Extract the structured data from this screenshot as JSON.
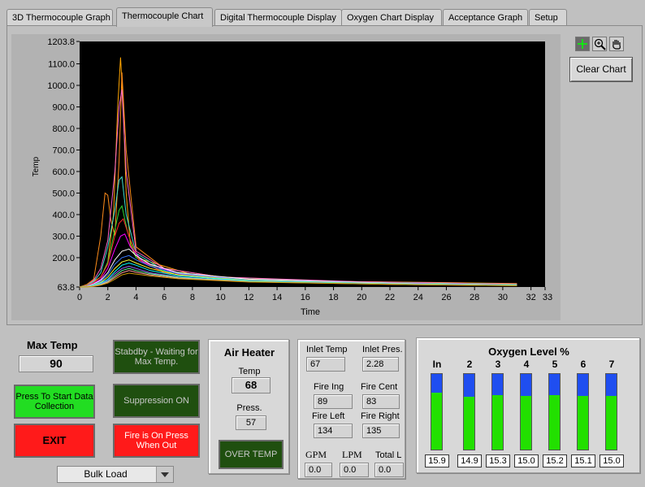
{
  "tabs": [
    {
      "label": "3D Thermocouple Graph"
    },
    {
      "label": "Thermocouple Chart"
    },
    {
      "label": "Digital Thermocouple Display"
    },
    {
      "label": "Oxygen Chart Display"
    },
    {
      "label": "Acceptance Graph"
    },
    {
      "label": "Setup"
    }
  ],
  "active_tab": "Thermocouple Chart",
  "chart_data": {
    "type": "line",
    "ylabel": "Temp",
    "xlabel": "Time",
    "ylim": [
      63.8,
      1203.8
    ],
    "xlim": [
      0,
      33
    ],
    "y_ticks": [
      "63.8",
      "200.0",
      "300.0",
      "400.0",
      "500.0",
      "600.0",
      "700.0",
      "800.0",
      "900.0",
      "1000.0",
      "1100.0",
      "1203.8"
    ],
    "x_ticks": [
      "0",
      "2",
      "4",
      "6",
      "8",
      "10",
      "12",
      "14",
      "16",
      "18",
      "20",
      "22",
      "24",
      "26",
      "28",
      "30",
      "32",
      "33"
    ],
    "grid": false,
    "background": "#000000",
    "series": [
      {
        "color": "#ffa500",
        "x": [
          0,
          0.5,
          1,
          1.5,
          2,
          2.4,
          2.7,
          2.9,
          3.1,
          3.3,
          3.6,
          4,
          5,
          6,
          8,
          12,
          18,
          25,
          31
        ],
        "y": [
          63.8,
          70,
          90,
          110,
          180,
          400,
          900,
          1130,
          900,
          500,
          260,
          200,
          180,
          160,
          120,
          100,
          90,
          85,
          80
        ]
      },
      {
        "color": "#ff8c1a",
        "x": [
          0,
          0.5,
          1,
          1.5,
          1.8,
          2,
          2.2,
          2.5,
          2.8,
          3.0,
          3.3,
          4,
          6,
          10,
          18,
          31
        ],
        "y": [
          63.8,
          75,
          100,
          300,
          500,
          490,
          380,
          300,
          650,
          1060,
          700,
          250,
          150,
          110,
          90,
          78
        ]
      },
      {
        "color": "#ff66cc",
        "x": [
          0,
          0.5,
          1,
          1.5,
          2,
          2.5,
          2.8,
          3.0,
          3.3,
          4,
          6,
          10,
          20,
          31
        ],
        "y": [
          63.8,
          70,
          95,
          150,
          280,
          600,
          900,
          980,
          600,
          230,
          150,
          110,
          88,
          78
        ]
      },
      {
        "color": "#40e0d0",
        "x": [
          0,
          0.5,
          1,
          1.5,
          2,
          2.5,
          2.8,
          3.0,
          3.3,
          4,
          6,
          10,
          20,
          31
        ],
        "y": [
          63.8,
          70,
          90,
          130,
          250,
          420,
          560,
          575,
          400,
          220,
          140,
          105,
          85,
          76
        ]
      },
      {
        "color": "#2ed82e",
        "x": [
          0,
          0.5,
          1,
          1.5,
          2,
          2.5,
          2.8,
          3.0,
          3.4,
          4,
          6,
          10,
          20,
          31
        ],
        "y": [
          63.8,
          70,
          85,
          110,
          180,
          330,
          420,
          440,
          320,
          200,
          135,
          105,
          84,
          76
        ]
      },
      {
        "color": "#ff2a2a",
        "x": [
          0,
          0.5,
          1,
          1.5,
          2,
          2.5,
          2.8,
          3.1,
          3.5,
          4.2,
          6,
          10,
          20,
          31
        ],
        "y": [
          63.8,
          68,
          85,
          110,
          170,
          300,
          360,
          380,
          300,
          190,
          130,
          100,
          83,
          75
        ]
      },
      {
        "color": "#ff00ff",
        "x": [
          0,
          0.5,
          1,
          1.5,
          2,
          2.5,
          2.9,
          3.2,
          3.6,
          4.5,
          7,
          12,
          22,
          31
        ],
        "y": [
          63.8,
          68,
          80,
          100,
          150,
          240,
          300,
          310,
          250,
          180,
          125,
          95,
          82,
          74
        ]
      },
      {
        "color": "#ffffff",
        "x": [
          0,
          0.5,
          1,
          1.5,
          2,
          2.5,
          3,
          3.5,
          4,
          5,
          7,
          12,
          22,
          31
        ],
        "y": [
          63.8,
          67,
          78,
          95,
          130,
          190,
          230,
          240,
          210,
          170,
          130,
          100,
          82,
          74
        ]
      },
      {
        "color": "#3a7bff",
        "x": [
          0,
          0.5,
          1,
          1.5,
          2,
          2.5,
          3,
          3.5,
          4,
          5,
          7,
          12,
          22,
          31
        ],
        "y": [
          63.8,
          66,
          76,
          90,
          120,
          170,
          200,
          210,
          190,
          160,
          125,
          96,
          80,
          73
        ]
      },
      {
        "color": "#ffff33",
        "x": [
          0,
          0.5,
          1,
          1.5,
          2,
          2.5,
          3,
          3.5,
          4,
          5,
          7,
          12,
          22,
          31
        ],
        "y": [
          63.8,
          66,
          74,
          85,
          110,
          150,
          180,
          190,
          175,
          150,
          120,
          94,
          79,
          72
        ]
      },
      {
        "color": "#00ffff",
        "x": [
          0,
          0.5,
          1,
          1.5,
          2,
          2.5,
          3,
          3.5,
          4,
          5,
          7,
          12,
          22,
          31
        ],
        "y": [
          63.8,
          65,
          72,
          82,
          100,
          135,
          165,
          175,
          165,
          140,
          115,
          92,
          78,
          72
        ]
      },
      {
        "color": "#9966ff",
        "x": [
          0,
          0.5,
          1,
          1.5,
          2,
          2.5,
          3,
          3.5,
          4,
          5,
          7,
          12,
          22,
          31
        ],
        "y": [
          63.8,
          65,
          70,
          78,
          95,
          125,
          150,
          160,
          150,
          130,
          110,
          90,
          77,
          71
        ]
      },
      {
        "color": "#66ff99",
        "x": [
          0,
          0.5,
          1,
          1.5,
          2,
          2.5,
          3,
          3.5,
          4,
          5,
          7,
          12,
          22,
          31
        ],
        "y": [
          63.8,
          65,
          69,
          76,
          90,
          115,
          140,
          150,
          140,
          125,
          108,
          89,
          77,
          71
        ]
      },
      {
        "color": "#ff9999",
        "x": [
          0,
          0.5,
          1,
          1.5,
          2,
          2.5,
          3,
          3.5,
          4,
          5,
          7,
          12,
          22,
          31
        ],
        "y": [
          63.8,
          64,
          68,
          74,
          86,
          108,
          130,
          140,
          132,
          120,
          105,
          88,
          76,
          70
        ]
      },
      {
        "color": "#cc9900",
        "x": [
          0,
          0.5,
          1,
          1.5,
          2,
          2.5,
          3,
          3.5,
          4,
          5,
          7,
          12,
          22,
          31
        ],
        "y": [
          63.8,
          64,
          67,
          72,
          82,
          100,
          120,
          128,
          124,
          115,
          102,
          87,
          76,
          70
        ]
      }
    ]
  },
  "buttons": {
    "clear_chart": "Clear Chart",
    "start_collection": "Press To Start Data Collection",
    "exit": "EXIT",
    "standby": "Stabdby - Waiting for Max Temp.",
    "suppression": "Suppression ON",
    "fire": "Fire is On Press When Out",
    "over_temp": "OVER TEMP"
  },
  "max_temp": {
    "label": "Max Temp",
    "value": "90"
  },
  "load_select": {
    "value": "Bulk Load"
  },
  "air_heater": {
    "title": "Air Heater",
    "temp_label": "Temp",
    "temp_value": "68",
    "press_label": "Press.",
    "press_value": "57"
  },
  "readings": {
    "inlet_temp_label": "Inlet Temp",
    "inlet_temp": "67",
    "inlet_pres_label": "Inlet Pres.",
    "inlet_pres": "2.28",
    "fire_ing_label": "Fire Ing",
    "fire_ing": "89",
    "fire_cent_label": "Fire Cent",
    "fire_cent": "83",
    "fire_left_label": "Fire Left",
    "fire_left": "134",
    "fire_right_label": "Fire Right",
    "fire_right": "135",
    "gpm_label": "GPM",
    "gpm": "0.0",
    "lpm_label": "LPM",
    "lpm": "0.0",
    "total_label": "Total L",
    "total": "0.0"
  },
  "oxygen": {
    "title": "Oxygen Level %",
    "scale_max": 21,
    "bars": [
      {
        "label": "In",
        "value": "15.9",
        "level": 15.9
      },
      {
        "label": "2",
        "value": "14.9",
        "level": 14.9
      },
      {
        "label": "3",
        "value": "15.3",
        "level": 15.3
      },
      {
        "label": "4",
        "value": "15.0",
        "level": 15.0
      },
      {
        "label": "5",
        "value": "15.2",
        "level": 15.2
      },
      {
        "label": "6",
        "value": "15.1",
        "level": 15.1
      },
      {
        "label": "7",
        "value": "15.0",
        "level": 15.0
      }
    ]
  }
}
